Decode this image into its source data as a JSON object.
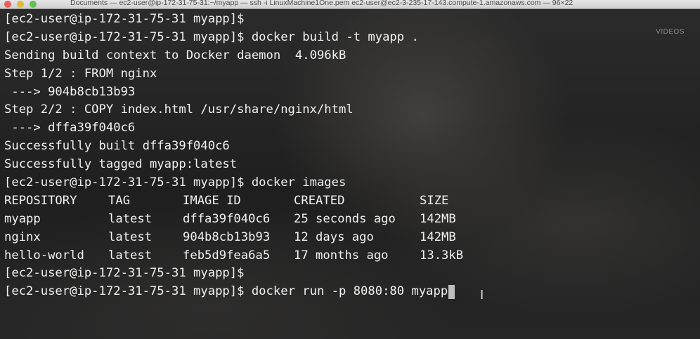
{
  "window": {
    "title": "Documents — ec2-user@ip-172-31-75-31:~/myapp — ssh -i LinuxMachine1One.pem ec2-user@ec2-3-235-17-143.compute-1.amazonaws.com — 96×22",
    "watermark": "VIDEOS"
  },
  "terminal": {
    "lines": [
      "[ec2-user@ip-172-31-75-31 myapp]$",
      "[ec2-user@ip-172-31-75-31 myapp]$ docker build -t myapp .",
      "Sending build context to Docker daemon  4.096kB",
      "Step 1/2 : FROM nginx",
      " ---> 904b8cb13b93",
      "Step 2/2 : COPY index.html /usr/share/nginx/html",
      " ---> dffa39f040c6",
      "Successfully built dffa39f040c6",
      "Successfully tagged myapp:latest",
      "[ec2-user@ip-172-31-75-31 myapp]$ docker images"
    ],
    "images_table": {
      "headers": [
        "REPOSITORY",
        "TAG",
        "IMAGE ID",
        "CREATED",
        "SIZE"
      ],
      "rows": [
        [
          "myapp",
          "latest",
          "dffa39f040c6",
          "25 seconds ago",
          "142MB"
        ],
        [
          "nginx",
          "latest",
          "904b8cb13b93",
          "12 days ago",
          "142MB"
        ],
        [
          "hello-world",
          "latest",
          "feb5d9fea6a5",
          "17 months ago",
          "13.3kB"
        ]
      ]
    },
    "after_lines": [
      "[ec2-user@ip-172-31-75-31 myapp]$"
    ],
    "prompt": "[ec2-user@ip-172-31-75-31 myapp]$ ",
    "current_input": "docker run -p 8080:80 myapp"
  },
  "icons": {
    "close": "close-icon",
    "minimize": "minimize-icon",
    "zoom": "zoom-icon",
    "text_cursor": "i-beam-cursor-icon"
  }
}
